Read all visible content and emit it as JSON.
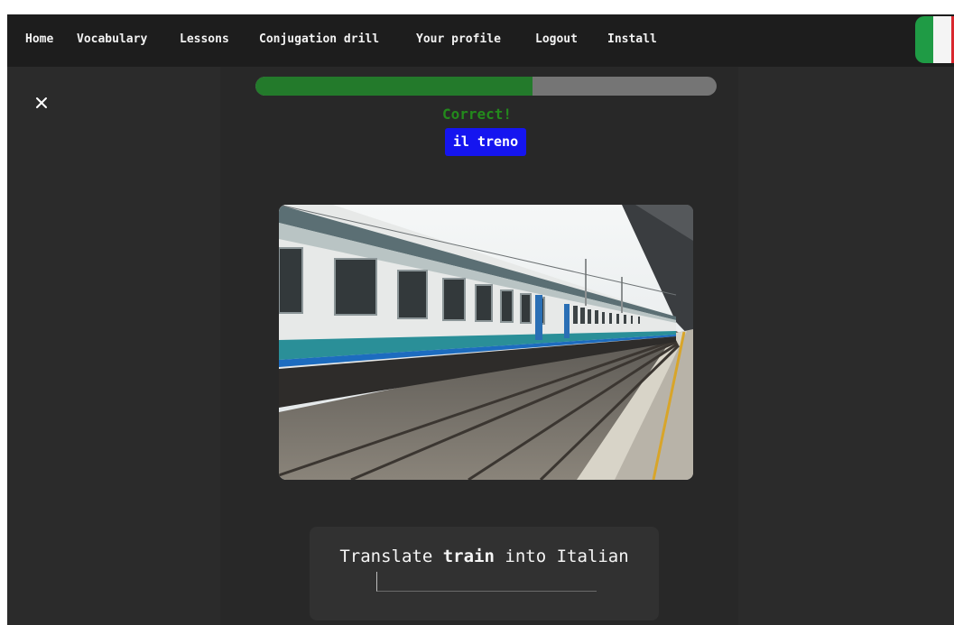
{
  "nav": {
    "items": [
      {
        "label": "Home"
      },
      {
        "label": "Vocabulary"
      },
      {
        "label": "Lessons"
      },
      {
        "label": "Conjugation drill"
      },
      {
        "label": "Your profile"
      },
      {
        "label": "Logout"
      },
      {
        "label": "Install"
      }
    ],
    "flag_icon": "italy-flag-icon"
  },
  "quiz": {
    "close_icon": "close-icon",
    "progress": 0.6,
    "feedback": "Correct!",
    "answer": "il treno",
    "image_icon": "train-photo",
    "prompt_before": "Translate",
    "prompt_word": "train",
    "prompt_after": "into Italian",
    "input_value": ""
  },
  "colors": {
    "accent_green": "#238a1c",
    "answer_badge": "#1515f0",
    "progress_fill": "#237a2b",
    "progress_track": "#757575"
  }
}
